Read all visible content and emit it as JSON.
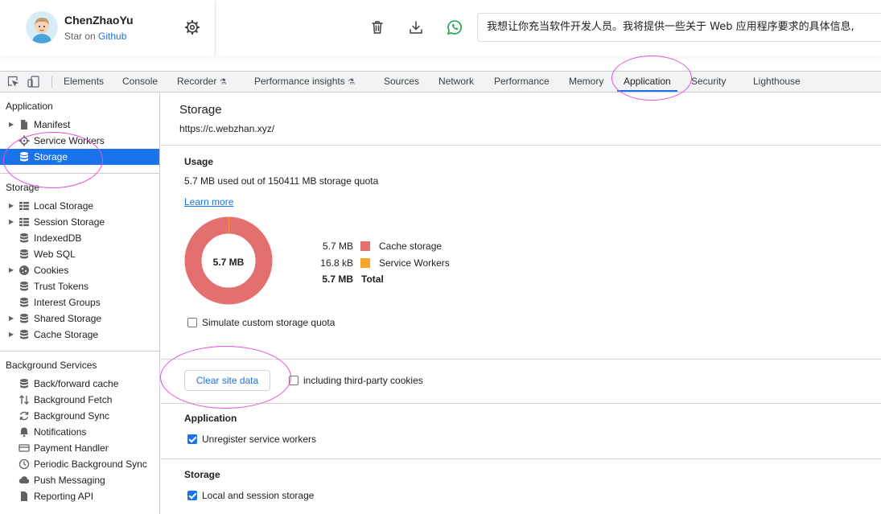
{
  "header": {
    "user_name": "ChenZhaoYu",
    "star_prefix": "Star on ",
    "star_link": "Github",
    "prompt_text": "我想让你充当软件开发人员。我将提供一些关于 Web 应用程序要求的具体信息,",
    "icons": [
      "gear-icon",
      "trash-icon",
      "download-icon",
      "whatsapp-icon"
    ]
  },
  "devtools": {
    "tabs": [
      {
        "label": "Elements"
      },
      {
        "label": "Console"
      },
      {
        "label": "Recorder",
        "badge": "⚗"
      },
      {
        "label": "Performance insights",
        "badge": "⚗"
      },
      {
        "label": "Sources"
      },
      {
        "label": "Network"
      },
      {
        "label": "Performance"
      },
      {
        "label": "Memory"
      },
      {
        "label": "Application",
        "active": true
      },
      {
        "label": "Security"
      },
      {
        "label": "Lighthouse"
      }
    ]
  },
  "sidebar": {
    "application_title": "Application",
    "application_items": [
      {
        "label": "Manifest",
        "icon": "document-icon",
        "expandable": true
      },
      {
        "label": "Service Workers",
        "icon": "gear-icon"
      },
      {
        "label": "Storage",
        "icon": "database-icon",
        "selected": true
      }
    ],
    "storage_title": "Storage",
    "storage_items": [
      {
        "label": "Local Storage",
        "icon": "grid-icon",
        "expandable": true
      },
      {
        "label": "Session Storage",
        "icon": "grid-icon",
        "expandable": true
      },
      {
        "label": "IndexedDB",
        "icon": "database-icon"
      },
      {
        "label": "Web SQL",
        "icon": "database-icon"
      },
      {
        "label": "Cookies",
        "icon": "cookie-icon",
        "expandable": true
      },
      {
        "label": "Trust Tokens",
        "icon": "database-icon"
      },
      {
        "label": "Interest Groups",
        "icon": "database-icon"
      },
      {
        "label": "Shared Storage",
        "icon": "database-icon",
        "expandable": true
      },
      {
        "label": "Cache Storage",
        "icon": "database-icon",
        "expandable": true
      }
    ],
    "background_title": "Background Services",
    "background_items": [
      {
        "label": "Back/forward cache",
        "icon": "database-icon"
      },
      {
        "label": "Background Fetch",
        "icon": "arrows-icon"
      },
      {
        "label": "Background Sync",
        "icon": "sync-icon"
      },
      {
        "label": "Notifications",
        "icon": "bell-icon"
      },
      {
        "label": "Payment Handler",
        "icon": "card-icon"
      },
      {
        "label": "Periodic Background Sync",
        "icon": "clock-icon"
      },
      {
        "label": "Push Messaging",
        "icon": "cloud-icon"
      },
      {
        "label": "Reporting API",
        "icon": "document-icon"
      }
    ]
  },
  "main": {
    "title": "Storage",
    "origin": "https://c.webzhan.xyz/",
    "usage": {
      "title": "Usage",
      "text": "5.7 MB used out of 150411 MB storage quota",
      "learn_more": "Learn more",
      "donut_center": "5.7 MB",
      "colors": {
        "cache": "#e46f6f",
        "service_workers": "#f7a62b"
      },
      "legend": [
        {
          "value": "5.7 MB",
          "name": "Cache storage",
          "color": "#e46f6f"
        },
        {
          "value": "16.8 kB",
          "name": "Service Workers",
          "color": "#f7a62b"
        },
        {
          "value": "5.7 MB",
          "name": "Total",
          "total": true
        }
      ],
      "service_workers_fraction": 0.003,
      "simulate_label": "Simulate custom storage quota",
      "simulate_checked": false
    },
    "clear": {
      "button": "Clear site data",
      "third_party_label": "including third-party cookies",
      "third_party_checked": false
    },
    "application_section": {
      "title": "Application",
      "unregister_label": "Unregister service workers",
      "unregister_checked": true
    },
    "storage_section": {
      "title": "Storage",
      "local_session_label": "Local and session storage",
      "local_session_checked": true
    }
  }
}
